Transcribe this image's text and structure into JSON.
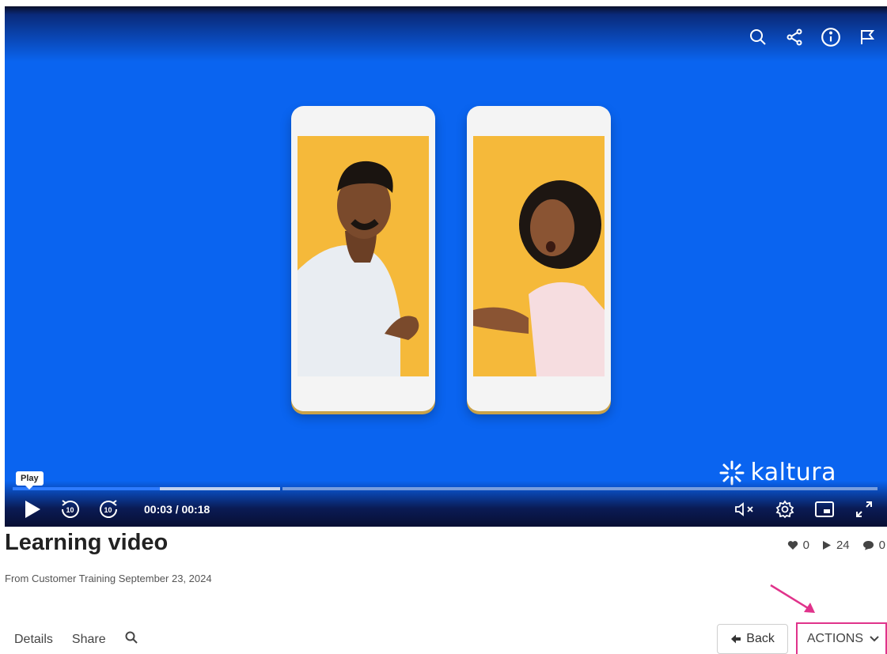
{
  "player": {
    "tooltip": "Play",
    "time": "00:03 / 00:18",
    "brand": "kaltura",
    "progress_played": 0.17,
    "top_icons": [
      "search-icon",
      "share-icon",
      "info-icon",
      "flag-icon"
    ],
    "bottom_icons": [
      "play-icon",
      "rewind-10-icon",
      "forward-10-icon",
      "mute-icon",
      "settings-icon",
      "picture-in-picture-icon",
      "fullscreen-icon"
    ],
    "colors": {
      "background": "#0a64f0",
      "accent": "#2e7bff"
    }
  },
  "media": {
    "title": "Learning video",
    "subtitle": "From Customer Training September 23, 2024",
    "likes": "0",
    "plays": "24",
    "comments": "0"
  },
  "tabs": [
    {
      "label": "Details"
    },
    {
      "label": "Share"
    }
  ],
  "buttons": {
    "back": "Back",
    "actions": "ACTIONS"
  },
  "colors": {
    "highlight": "#e0338b"
  }
}
